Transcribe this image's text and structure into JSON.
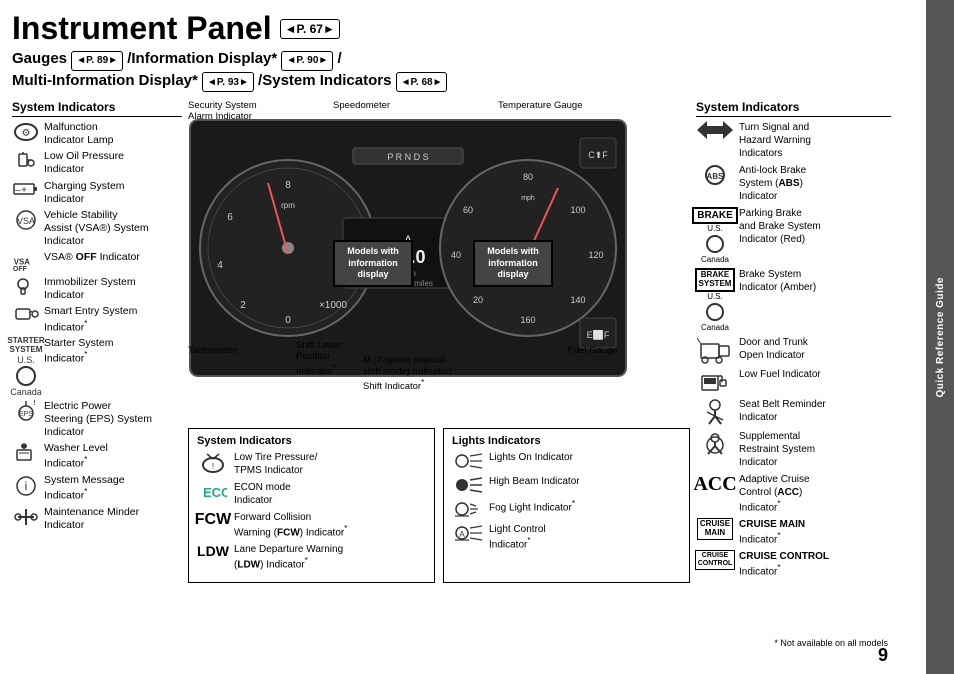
{
  "page": {
    "title": "Instrument Panel",
    "title_ref": "P. 67",
    "subtitle": "Gauges",
    "subtitle_parts": [
      {
        "text": "Gauges ",
        "ref": "P. 89"
      },
      {
        "text": "/Information Display* ",
        "ref": "P. 90"
      },
      {
        "text": "/ Multi-Information Display* ",
        "ref": "P. 93"
      },
      {
        "text": "/System Indicators ",
        "ref": "P. 68"
      }
    ],
    "page_number": "9",
    "footnote": "* Not available on all models",
    "sidebar_label": "Quick Reference Guide"
  },
  "left_panel": {
    "title": "System Indicators",
    "indicators": [
      {
        "icon": "⚙",
        "label": "Malfunction Indicator Lamp"
      },
      {
        "icon": "🛢",
        "label": "Low Oil Pressure Indicator"
      },
      {
        "icon": "🔋",
        "label": "Charging System Indicator"
      },
      {
        "icon": "🚗",
        "label": "Vehicle Stability Assist (VSA®) System Indicator"
      },
      {
        "icon": "VSA OFF",
        "label": "VSA® OFF Indicator"
      },
      {
        "icon": "🔑",
        "label": "Immobilizer System Indicator"
      },
      {
        "icon": "🚪",
        "label": "Smart Entry System Indicator*"
      },
      {
        "icon": "STARTER",
        "label": "Starter System Indicator*",
        "us_canada": true
      },
      {
        "icon": "⚡",
        "label": "Electric Power Steering (EPS) System Indicator"
      },
      {
        "icon": "🧴",
        "label": "Washer Level Indicator*"
      },
      {
        "icon": "ℹ",
        "label": "System Message Indicator*"
      },
      {
        "icon": "🔧",
        "label": "Maintenance Minder Indicator"
      }
    ]
  },
  "dashboard": {
    "callouts": {
      "security_alarm": "Security System\nAlarm Indicator",
      "speedometer": "Speedometer",
      "temperature_gauge": "Temperature Gauge",
      "tachometer": "Tachometer",
      "shift_lever": "Shift Lever\nPosition\nIndicator*",
      "m_mode": "M (7-speed manual\nshift mode) Indicator/\nShift Indicator*",
      "fuel_gauge": "Fuel Gauge"
    },
    "info_boxes": [
      "Models with\ninformation\ndisplay",
      "Models with\ninformation\ndisplay"
    ]
  },
  "system_indicators_box": {
    "title": "System Indicators",
    "items": [
      {
        "icon": "tire",
        "label": "Low Tire Pressure/\nTPMS Indicator"
      },
      {
        "icon": "econ",
        "label": "ECON mode\nIndicator"
      },
      {
        "icon": "FCW",
        "label": "Forward Collision\nWarning (FCW) Indicator*"
      },
      {
        "icon": "LDW",
        "label": "Lane Departure Warning\n(LDW) Indicator*"
      }
    ]
  },
  "lights_indicators_box": {
    "title": "Lights Indicators",
    "items": [
      {
        "icon": "lights",
        "label": "Lights On Indicator"
      },
      {
        "icon": "highbeam",
        "label": "High Beam Indicator"
      },
      {
        "icon": "fog",
        "label": "Fog Light Indicator*"
      },
      {
        "icon": "light_control",
        "label": "Light Control\nIndicator*"
      }
    ]
  },
  "right_panel": {
    "title": "System Indicators",
    "indicators": [
      {
        "icon": "arrows",
        "label": "Turn Signal and\nHazard Warning\nIndicators"
      },
      {
        "icon": "ABS",
        "label": "Anti-lock Brake\nSystem (ABS)\nIndicator"
      },
      {
        "icon": "BRAKE_US",
        "label": "Parking Brake\nand Brake System\nIndicator (Red)",
        "sublabel": "U.S."
      },
      {
        "icon": "circle_canada",
        "label": "",
        "sublabel": "Canada"
      },
      {
        "icon": "BRAKE_SYSTEM_US",
        "label": "Brake System\nIndicator (Amber)",
        "sublabel": "U.S."
      },
      {
        "icon": "circle_canada2",
        "label": "",
        "sublabel": "Canada"
      },
      {
        "icon": "door",
        "label": "Door and Trunk\nOpen Indicator"
      },
      {
        "icon": "fuel",
        "label": "Low Fuel Indicator"
      },
      {
        "icon": "seatbelt",
        "label": "Seat Belt Reminder\nIndicator"
      },
      {
        "icon": "srs",
        "label": "Supplemental\nRestraint System\nIndicator"
      },
      {
        "icon": "ACC",
        "label": "Adaptive Cruise\nControl (ACC)\nIndicator*"
      },
      {
        "icon": "CRUISE_MAIN",
        "label": "CRUISE MAIN\nIndicator*"
      },
      {
        "icon": "CRUISE_CONTROL",
        "label": "CRUISE CONTROL\nIndicator*"
      }
    ]
  }
}
